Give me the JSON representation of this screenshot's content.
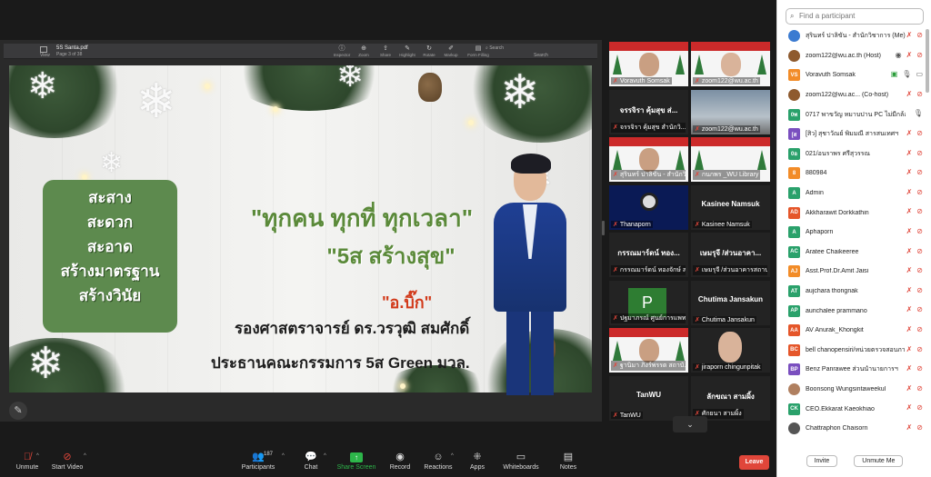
{
  "pdf": {
    "doc_name": "5S Santa.pdf",
    "page_info": "Page 3 of 38",
    "view_label": "View",
    "tools": [
      {
        "icon": "info-icon",
        "label": "Inspector"
      },
      {
        "icon": "zoom-icon",
        "label": "Zoom"
      },
      {
        "icon": "share-icon",
        "label": "Share"
      },
      {
        "icon": "highlight-icon",
        "label": "Highlight"
      },
      {
        "icon": "rotate-icon",
        "label": "Rotate"
      },
      {
        "icon": "markup-icon",
        "label": "Markup"
      },
      {
        "icon": "form-icon",
        "label": "Form Filling"
      }
    ],
    "search_placeholder": "Search",
    "search_label": "Search"
  },
  "slide": {
    "box_lines": [
      "สะสาง",
      "สะดวก",
      "สะอาด",
      "สร้างมาตรฐาน",
      "สร้างวินัย"
    ],
    "slogan_line1": "\"ทุกคน ทุกที่ ทุกเวลา\"",
    "slogan_line2": "\"5ส สร้างสุข\"",
    "nickname": "\"อ.บิ๊ก\"",
    "person_line1": "รองศาสตราจารย์ ดร.วรวุฒิ สมศักดิ์",
    "person_line2": "ประธานคณะกรรมการ 5ส Green มวล."
  },
  "gallery": [
    {
      "name": "Voravuth Somsak",
      "type": "xmas",
      "active": true
    },
    {
      "name": "zoom122@wu.ac.th",
      "type": "xmas2"
    },
    {
      "name": "จรรจิรา คุ้มสุข สำนักวิ...",
      "big": "จรรจิรา คุ้มสุข ส่...",
      "type": "text"
    },
    {
      "name": "zoom122@wu.ac.th",
      "type": "room"
    },
    {
      "name": "สุรินทร์ ปาลิขัน - สำนักวิชา...",
      "type": "xmas"
    },
    {
      "name": "กนกพร _WU Library",
      "type": "xmas3"
    },
    {
      "name": "Thanaporn",
      "type": "obs"
    },
    {
      "name": "Kasinee Namsuk",
      "big": "Kasinee Namsuk",
      "type": "text"
    },
    {
      "name": "กรรณมาร์ดน์ ทองจักษ์ สาร...",
      "big": "กรรณมาร์ดน์ ทอง...",
      "type": "text"
    },
    {
      "name": "เษมรุจี /ส่วนอาคารสถานที่",
      "big": "เษมรุจี /ส่วนอาคา...",
      "type": "text"
    },
    {
      "name": "ปฐมาภรณ์ ศูนย์การแพทย์",
      "type": "avatar",
      "letter": "P"
    },
    {
      "name": "Chutima Jansakun",
      "big": "Chutima Jansakun",
      "type": "text"
    },
    {
      "name": "ฐานิมา ภิงร์พรรต สถาบั...",
      "type": "xmas4"
    },
    {
      "name": "jiraporn chingunpitak",
      "type": "woman"
    },
    {
      "name": "TanWU",
      "big": "TanWU",
      "type": "text"
    },
    {
      "name": "ศักยนา สามผิ้ง",
      "big": "ลักขณา สามผิ้ง",
      "type": "text"
    }
  ],
  "participants": {
    "search_placeholder": "Find a participant",
    "list": [
      {
        "name": "สุรินทร์ ปาลิขัน - สำนักวิชาการ (Me)",
        "avatar": "img",
        "color": "#3b7bd1",
        "letter": "",
        "video": false
      },
      {
        "name": "zoom122@wu.ac.th (Host)",
        "avatar": "img",
        "color": "#8e5a2e",
        "letter": "",
        "video": false,
        "host": true
      },
      {
        "name": "Voravuth Somsak",
        "avatar": "letter",
        "color": "#f28c28",
        "letter": "VS",
        "video": true,
        "unmuted": true
      },
      {
        "name": "zoom122@wu.ac... (Co-host)",
        "avatar": "img",
        "color": "#8e5a2e",
        "letter": "",
        "video": false
      },
      {
        "name": "0717 พาขวัญ หมาบปาน PC ไม่มีกล้องครับ",
        "avatar": "letter",
        "color": "#2aa16b",
        "letter": "0พ",
        "video": false,
        "mic_only": true
      },
      {
        "name": "[สิว] สุชาวัณย์ พิมมณี สารสนเทศฯ",
        "avatar": "letter",
        "color": "#7a4fbf",
        "letter": "[ส",
        "video": false
      },
      {
        "name": "021/อนราพร ศรีสุวรรณ",
        "avatar": "letter",
        "color": "#2aa16b",
        "letter": "0อ",
        "video": false
      },
      {
        "name": "880984",
        "avatar": "letter",
        "color": "#f28c28",
        "letter": "8",
        "video": false
      },
      {
        "name": "Admin",
        "avatar": "letter",
        "color": "#2aa16b",
        "letter": "A",
        "video": false
      },
      {
        "name": "Akkharawit Dorkkathin",
        "avatar": "letter",
        "color": "#e5562a",
        "letter": "AD",
        "video": false
      },
      {
        "name": "Aphaporn",
        "avatar": "letter",
        "color": "#2aa16b",
        "letter": "A",
        "video": false
      },
      {
        "name": "Aratee Chaikeeree",
        "avatar": "letter",
        "color": "#2aa16b",
        "letter": "AC",
        "video": false
      },
      {
        "name": "Asst.Prof.Dr.Amit Jaisi",
        "avatar": "letter",
        "color": "#f28c28",
        "letter": "AJ",
        "video": false
      },
      {
        "name": "aujchara thongnak",
        "avatar": "letter",
        "color": "#2aa16b",
        "letter": "AT",
        "video": false
      },
      {
        "name": "aunchalee prammano",
        "avatar": "letter",
        "color": "#2aa16b",
        "letter": "AP",
        "video": false
      },
      {
        "name": "AV Anurak_Khongkit",
        "avatar": "letter",
        "color": "#e5562a",
        "letter": "AA",
        "video": false
      },
      {
        "name": "bell chanopensiri/หน่วยตรวจสอบภายใน",
        "avatar": "letter",
        "color": "#e5562a",
        "letter": "BC",
        "video": false
      },
      {
        "name": "Benz Panrawee ส่วนนำนายการฯ",
        "avatar": "letter",
        "color": "#7a4fbf",
        "letter": "BP",
        "video": false
      },
      {
        "name": "Boonsong Wungsintaweekul",
        "avatar": "img",
        "color": "#b08060",
        "letter": "",
        "video": false
      },
      {
        "name": "CEO.Ekkarat Kaeokhiao",
        "avatar": "letter",
        "color": "#2aa16b",
        "letter": "CK",
        "video": false
      },
      {
        "name": "Chattraphon Chaisorn",
        "avatar": "img",
        "color": "#555555",
        "letter": "",
        "video": false
      }
    ],
    "invite_label": "Invite",
    "unmute_me_label": "Unmute Me"
  },
  "toolbar": {
    "unmute": "Unmute",
    "start_video": "Start Video",
    "participants": "Participants",
    "participants_count": "187",
    "chat": "Chat",
    "share_screen": "Share Screen",
    "record": "Record",
    "reactions": "Reactions",
    "apps": "Apps",
    "whiteboards": "Whiteboards",
    "notes": "Notes",
    "leave": "Leave"
  }
}
